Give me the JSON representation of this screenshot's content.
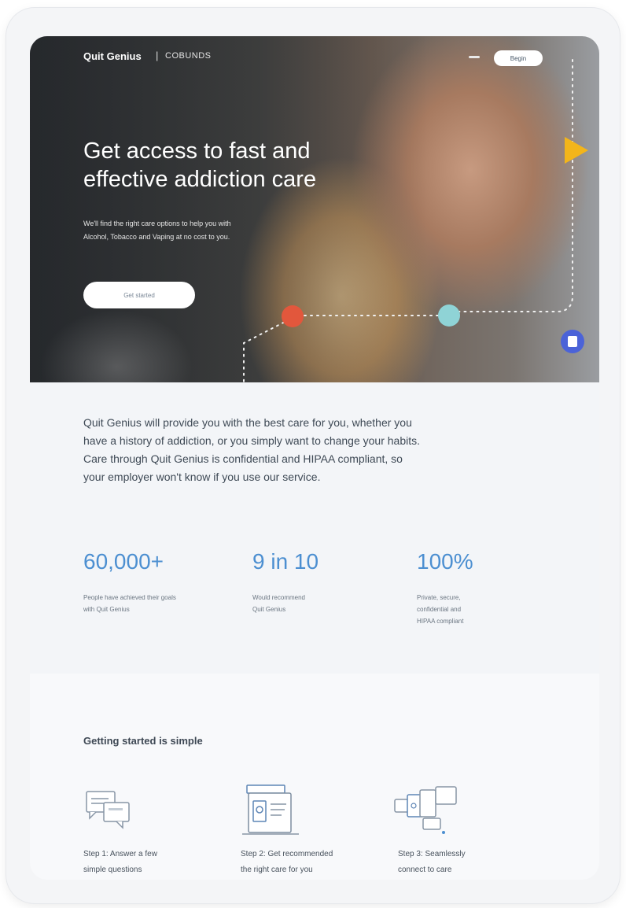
{
  "nav": {
    "logo": "Quit Genius",
    "separator": "|",
    "partner": "COBUNDS",
    "cta_label": "Begin"
  },
  "hero": {
    "title_line1": "Get access to fast and",
    "title_line2": "effective addiction care",
    "subtitle": "We'll find the right care options to help you with Alcohol, Tobacco and Vaping at no cost to you.",
    "cta_label": "Get started"
  },
  "intro": {
    "text": "Quit Genius will provide you with the best care for you, whether you have a history of addiction, or you simply want to change your habits. Care through Quit Genius is confidential and HIPAA compliant, so your employer won't know if you use our service."
  },
  "stats": [
    {
      "value": "60,000+",
      "caption_line1": "People have achieved their goals",
      "caption_line2": "with Quit Genius"
    },
    {
      "value": "9 in 10",
      "caption_line1": "Would recommend",
      "caption_line2": "Quit Genius"
    },
    {
      "value": "100%",
      "caption_line1": "Private, secure,",
      "caption_line2": "confidential and",
      "caption_line3": "HIPAA compliant"
    }
  ],
  "steps": {
    "title": "Getting started is simple",
    "items": [
      {
        "line1": "Step 1: Answer a few",
        "line2": "simple questions",
        "icon": "chat-bubbles-icon"
      },
      {
        "line1": "Step 2: Get recommended",
        "line2": "the right care for you",
        "icon": "care-plan-icon"
      },
      {
        "line1": "Step 3: Seamlessly",
        "line2": "connect to care",
        "icon": "connect-devices-icon"
      }
    ]
  },
  "colors": {
    "accent_blue": "#4c8fd1",
    "marker_orange": "#e2573c",
    "marker_teal": "#8fd3d6",
    "marker_yellow": "#f3b51a",
    "chat_badge": "#4b63d8"
  }
}
